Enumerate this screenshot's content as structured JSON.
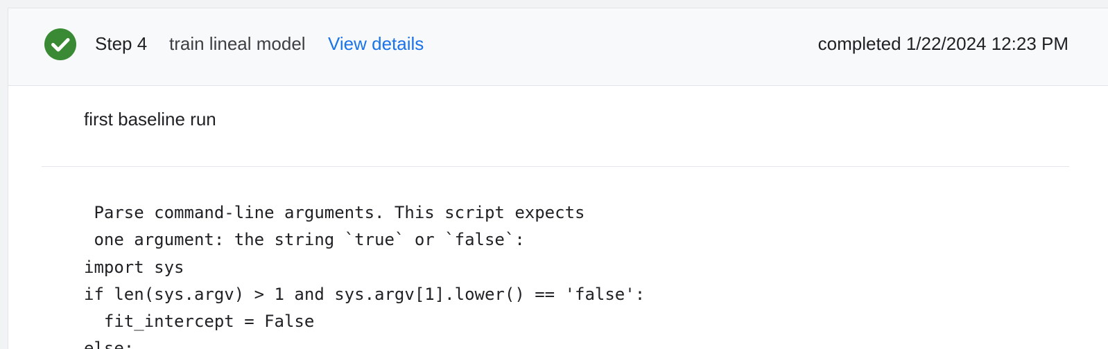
{
  "step": {
    "status": "completed",
    "status_icon": "check-circle-icon",
    "status_color": "#3a8a35",
    "label": "Step 4",
    "name": "train lineal model",
    "view_details_label": "View details",
    "completed_text": "completed 1/22/2024 12:23 PM"
  },
  "description": "first baseline run",
  "code_lines": [
    " Parse command-line arguments. This script expects",
    " one argument: the string `true` or `false`:",
    "import sys",
    "if len(sys.argv) > 1 and sys.argv[1].lower() == 'false':",
    "  fit_intercept = False",
    "else:"
  ],
  "colors": {
    "link": "#1a73e8",
    "header_background": "#f8f9fa",
    "page_background": "#f1f3f4"
  }
}
